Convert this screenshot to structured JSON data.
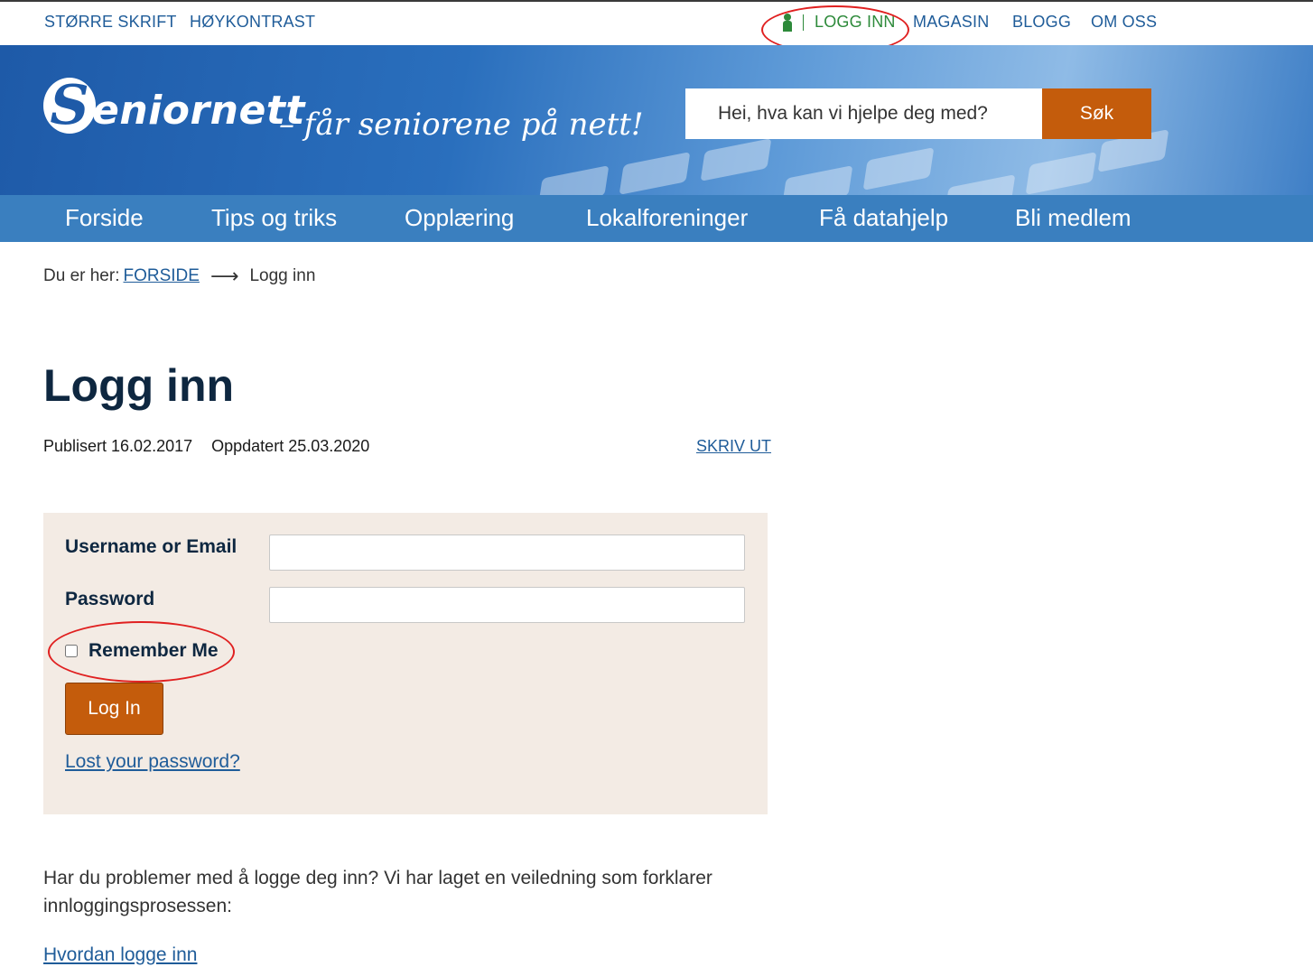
{
  "topbar": {
    "larger_text": "STØRRE SKRIFT",
    "high_contrast": "HØYKONTRAST",
    "login": "LOGG INN",
    "magazine": "MAGASIN",
    "blog": "BLOGG",
    "about": "OM OSS"
  },
  "header": {
    "logo_text": "eniornett",
    "tagline": "– får seniorene på nett!",
    "search_placeholder": "Hei, hva kan vi hjelpe deg med?",
    "search_button": "Søk"
  },
  "nav": {
    "items": [
      {
        "label": "Forside"
      },
      {
        "label": "Tips og triks"
      },
      {
        "label": "Opplæring"
      },
      {
        "label": "Lokalforeninger"
      },
      {
        "label": "Få datahjelp"
      },
      {
        "label": "Bli medlem"
      }
    ]
  },
  "breadcrumb": {
    "prefix": "Du er her:",
    "home": "FORSIDE",
    "current": "Logg inn"
  },
  "page": {
    "title": "Logg inn",
    "published": "Publisert 16.02.2017",
    "updated": "Oppdatert 25.03.2020",
    "print": "SKRIV UT"
  },
  "login_form": {
    "username_label": "Username or Email",
    "username_value": "",
    "password_label": "Password",
    "password_value": "",
    "remember_label": "Remember Me",
    "remember_checked": false,
    "submit_label": "Log In",
    "lost_password": "Lost your password?"
  },
  "help": {
    "text": "Har du problemer med å logge deg inn? Vi har laget en veiledning som forklarer innloggingsprosessen:",
    "link": "Hvordan logge inn"
  },
  "colors": {
    "link_blue": "#1f5c99",
    "nav_blue": "#3a7fbf",
    "accent_orange": "#c45c0c",
    "login_green": "#2d8a3a",
    "form_bg": "#f3ebe4",
    "annotation_red": "#e02020"
  }
}
